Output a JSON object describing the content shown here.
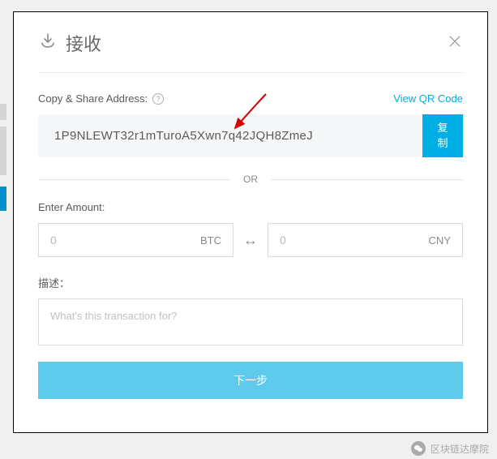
{
  "header": {
    "title": "接收"
  },
  "address": {
    "label": "Copy & Share Address:",
    "value": "1P9NLEWT32r1mTuroA5Xwn7q42JQH8ZmeJ",
    "view_qr": "View QR Code",
    "copy_line1": "复",
    "copy_line2": "制"
  },
  "divider": {
    "or": "OR"
  },
  "amount": {
    "label": "Enter Amount:",
    "placeholder_left": "0",
    "currency_left": "BTC",
    "placeholder_right": "0",
    "currency_right": "CNY"
  },
  "description": {
    "label": "描述：",
    "placeholder": "What's this transaction for?"
  },
  "actions": {
    "next": "下一步"
  },
  "watermark": {
    "text": "区块链达摩院"
  }
}
